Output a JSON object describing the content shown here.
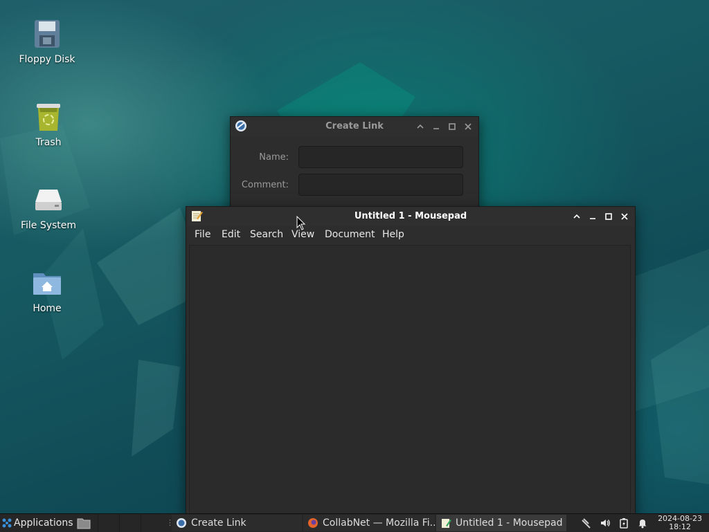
{
  "desktop": {
    "icons": [
      {
        "label": "Floppy Disk"
      },
      {
        "label": "Trash"
      },
      {
        "label": "File System"
      },
      {
        "label": "Home"
      }
    ]
  },
  "create_link_dialog": {
    "title": "Create Link",
    "name_label": "Name:",
    "name_value": "",
    "comment_label": "Comment:",
    "comment_value": ""
  },
  "mousepad": {
    "title": "Untitled 1 - Mousepad",
    "menu": [
      "File",
      "Edit",
      "Search",
      "View",
      "Document",
      "Help"
    ],
    "content": ""
  },
  "taskbar": {
    "applications_label": "Applications",
    "tasks": [
      {
        "label": "Create Link",
        "icon": "link-icon"
      },
      {
        "label": "CollabNet — Mozilla Fi...",
        "icon": "firefox-icon"
      },
      {
        "label": "Untitled 1 - Mousepad",
        "icon": "mousepad-icon"
      }
    ],
    "clock": {
      "date": "2024-08-23",
      "time": "18:12"
    }
  },
  "colors": {
    "panel_bg": "#262626",
    "window_bg": "#2d2d2d",
    "desktop_teal": "#1c5b63",
    "accent_blue": "#3a8fd9"
  }
}
